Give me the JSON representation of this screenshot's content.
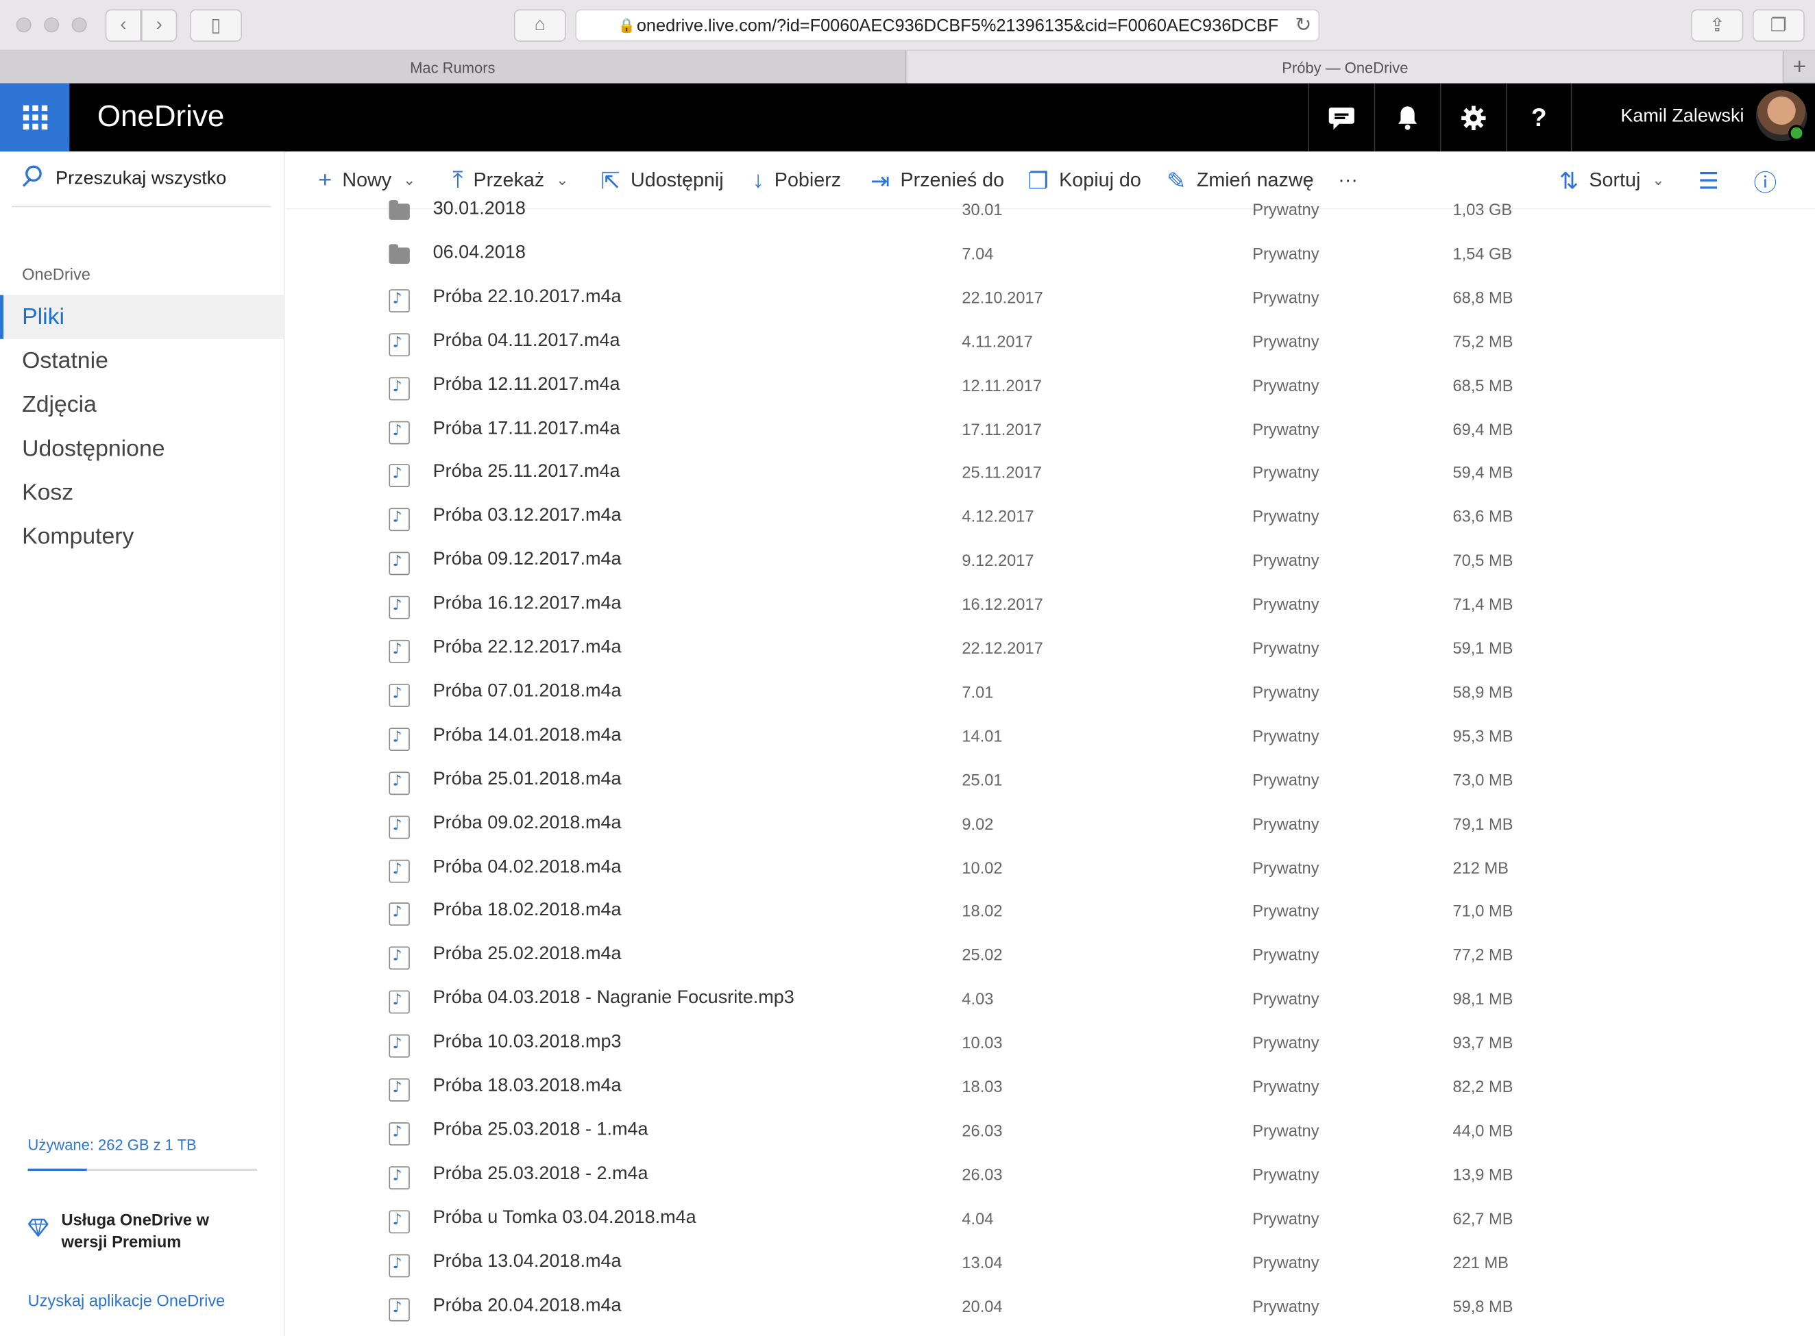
{
  "browser": {
    "url": "onedrive.live.com/?id=F0060AEC936DCBF5%21396135&cid=F0060AEC936DCBF",
    "tabs": [
      {
        "label": "Mac Rumors"
      },
      {
        "label": "Próby — OneDrive"
      }
    ]
  },
  "header": {
    "brand": "OneDrive",
    "user_name": "Kamil Zalewski",
    "help_label": "?"
  },
  "sidebar": {
    "search_placeholder": "Przeszukaj wszystko",
    "section_heading": "OneDrive",
    "items": [
      {
        "label": "Pliki",
        "selected": true
      },
      {
        "label": "Ostatnie"
      },
      {
        "label": "Zdjęcia"
      },
      {
        "label": "Udostępnione"
      },
      {
        "label": "Kosz"
      },
      {
        "label": "Komputery"
      }
    ],
    "quota_text": "Używane: 262 GB z 1 TB",
    "quota_fraction": 0.26,
    "premium_text": "Usługa OneDrive w wersji Premium",
    "get_apps": "Uzyskaj aplikacje OneDrive"
  },
  "toolbar": {
    "new_label": "Nowy",
    "upload_label": "Przekaż",
    "share_label": "Udostępnij",
    "download_label": "Pobierz",
    "move_label": "Przenieś do",
    "copy_label": "Kopiuj do",
    "rename_label": "Zmień nazwę",
    "more_label": "···",
    "sort_label": "Sortuj"
  },
  "files": [
    {
      "type": "folder",
      "name": "30.01.2018",
      "date": "30.01",
      "sharing": "Prywatny",
      "size": "1,03 GB"
    },
    {
      "type": "folder",
      "name": "06.04.2018",
      "date": "7.04",
      "sharing": "Prywatny",
      "size": "1,54 GB"
    },
    {
      "type": "audio",
      "name": "Próba 22.10.2017.m4a",
      "date": "22.10.2017",
      "sharing": "Prywatny",
      "size": "68,8 MB"
    },
    {
      "type": "audio",
      "name": "Próba 04.11.2017.m4a",
      "date": "4.11.2017",
      "sharing": "Prywatny",
      "size": "75,2 MB"
    },
    {
      "type": "audio",
      "name": "Próba 12.11.2017.m4a",
      "date": "12.11.2017",
      "sharing": "Prywatny",
      "size": "68,5 MB"
    },
    {
      "type": "audio",
      "name": "Próba 17.11.2017.m4a",
      "date": "17.11.2017",
      "sharing": "Prywatny",
      "size": "69,4 MB"
    },
    {
      "type": "audio",
      "name": "Próba 25.11.2017.m4a",
      "date": "25.11.2017",
      "sharing": "Prywatny",
      "size": "59,4 MB"
    },
    {
      "type": "audio",
      "name": "Próba 03.12.2017.m4a",
      "date": "4.12.2017",
      "sharing": "Prywatny",
      "size": "63,6 MB"
    },
    {
      "type": "audio",
      "name": "Próba 09.12.2017.m4a",
      "date": "9.12.2017",
      "sharing": "Prywatny",
      "size": "70,5 MB"
    },
    {
      "type": "audio",
      "name": "Próba 16.12.2017.m4a",
      "date": "16.12.2017",
      "sharing": "Prywatny",
      "size": "71,4 MB"
    },
    {
      "type": "audio",
      "name": "Próba 22.12.2017.m4a",
      "date": "22.12.2017",
      "sharing": "Prywatny",
      "size": "59,1 MB"
    },
    {
      "type": "audio",
      "name": "Próba 07.01.2018.m4a",
      "date": "7.01",
      "sharing": "Prywatny",
      "size": "58,9 MB"
    },
    {
      "type": "audio",
      "name": "Próba 14.01.2018.m4a",
      "date": "14.01",
      "sharing": "Prywatny",
      "size": "95,3 MB"
    },
    {
      "type": "audio",
      "name": "Próba 25.01.2018.m4a",
      "date": "25.01",
      "sharing": "Prywatny",
      "size": "73,0 MB"
    },
    {
      "type": "audio",
      "name": "Próba 09.02.2018.m4a",
      "date": "9.02",
      "sharing": "Prywatny",
      "size": "79,1 MB"
    },
    {
      "type": "audio",
      "name": "Próba 04.02.2018.m4a",
      "date": "10.02",
      "sharing": "Prywatny",
      "size": "212 MB"
    },
    {
      "type": "audio",
      "name": "Próba 18.02.2018.m4a",
      "date": "18.02",
      "sharing": "Prywatny",
      "size": "71,0 MB"
    },
    {
      "type": "audio",
      "name": "Próba 25.02.2018.m4a",
      "date": "25.02",
      "sharing": "Prywatny",
      "size": "77,2 MB"
    },
    {
      "type": "audio",
      "name": "Próba 04.03.2018 - Nagranie Focusrite.mp3",
      "date": "4.03",
      "sharing": "Prywatny",
      "size": "98,1 MB"
    },
    {
      "type": "audio",
      "name": "Próba 10.03.2018.mp3",
      "date": "10.03",
      "sharing": "Prywatny",
      "size": "93,7 MB"
    },
    {
      "type": "audio",
      "name": "Próba 18.03.2018.m4a",
      "date": "18.03",
      "sharing": "Prywatny",
      "size": "82,2 MB"
    },
    {
      "type": "audio",
      "name": "Próba 25.03.2018 - 1.m4a",
      "date": "26.03",
      "sharing": "Prywatny",
      "size": "44,0 MB"
    },
    {
      "type": "audio",
      "name": "Próba 25.03.2018 - 2.m4a",
      "date": "26.03",
      "sharing": "Prywatny",
      "size": "13,9 MB"
    },
    {
      "type": "audio",
      "name": "Próba u Tomka 03.04.2018.m4a",
      "date": "4.04",
      "sharing": "Prywatny",
      "size": "62,7 MB"
    },
    {
      "type": "audio",
      "name": "Próba 13.04.2018.m4a",
      "date": "13.04",
      "sharing": "Prywatny",
      "size": "221 MB"
    },
    {
      "type": "audio",
      "name": "Próba 20.04.2018.m4a",
      "date": "20.04",
      "sharing": "Prywatny",
      "size": "59,8 MB"
    }
  ]
}
